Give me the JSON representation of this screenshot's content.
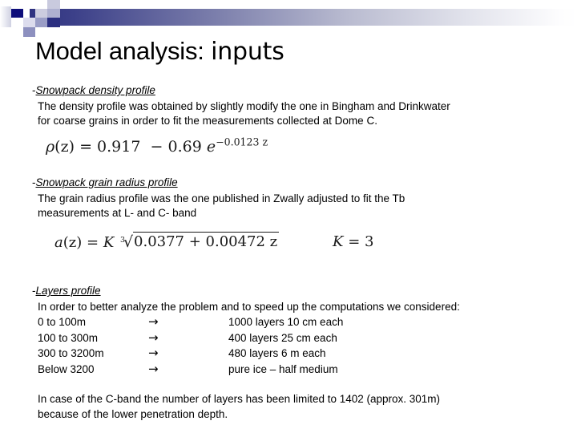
{
  "slide": {
    "title_main": "Model analysis: ",
    "title_accent": "inputs"
  },
  "sections": [
    {
      "dash": "-",
      "heading": "Snowpack density profile",
      "lines": [
        "The density profile was obtained by slightly modify the one in Bingham and Drinkwater",
        "for coarse grains in order to fit the measurements collected at Dome C."
      ]
    },
    {
      "dash": "-",
      "heading": "Snowpack grain radius profile",
      "lines": [
        "The grain radius profile was the one published in Zwally adjusted to fit the Tb",
        "measurements at L- and C- band"
      ]
    },
    {
      "dash": "-",
      "heading": "Layers profile",
      "lines": [
        "In order to better analyze the problem and to speed up the computations we considered:"
      ]
    }
  ],
  "equations": {
    "density": {
      "lhs_var": "ρ",
      "lhs_arg": "(z)",
      "eq_sign": "=",
      "term1": "0.917",
      "operator": "−",
      "coefficient": "0.69",
      "exp_base": "e",
      "exp_power": "−0.0123 z",
      "full_text": "ρ(z) = 0.917 − 0.69 e^(−0.0123 z)"
    },
    "grain_radius": {
      "lhs_var": "a",
      "lhs_arg": "(z)",
      "eq_sign": "=",
      "constant": "K",
      "root_index": "3",
      "radicand": "0.0377 + 0.00472 z",
      "full_text": "a(z) = K ∛(0.0377 + 0.00472 z)"
    },
    "k_value": {
      "symbol": "K",
      "eq_sign": "=",
      "value": "3",
      "full_text": "K = 3"
    }
  },
  "layers_table": {
    "arrow_glyph": "→",
    "rows": [
      {
        "range": "0 to 100m",
        "arrow": "→",
        "description": "1000 layers 10 cm each"
      },
      {
        "range": "100 to 300m",
        "arrow": "→",
        "description": "400 layers 25 cm each"
      },
      {
        "range": "300 to 3200m",
        "arrow": "→",
        "description": "480 layers 6 m each"
      },
      {
        "range": "Below 3200",
        "arrow": "→",
        "description": "pure ice – half medium"
      }
    ]
  },
  "closing_note": {
    "line1": "In case  of the C-band the number of layers has been limited to 1402 (approx. 301m)",
    "line2": "because of the lower penetration depth."
  },
  "colors": {
    "gradient_start": "#2e3180",
    "gradient_end": "#ffffff",
    "accent_square": "#0d0d7a",
    "text": "#000000"
  }
}
